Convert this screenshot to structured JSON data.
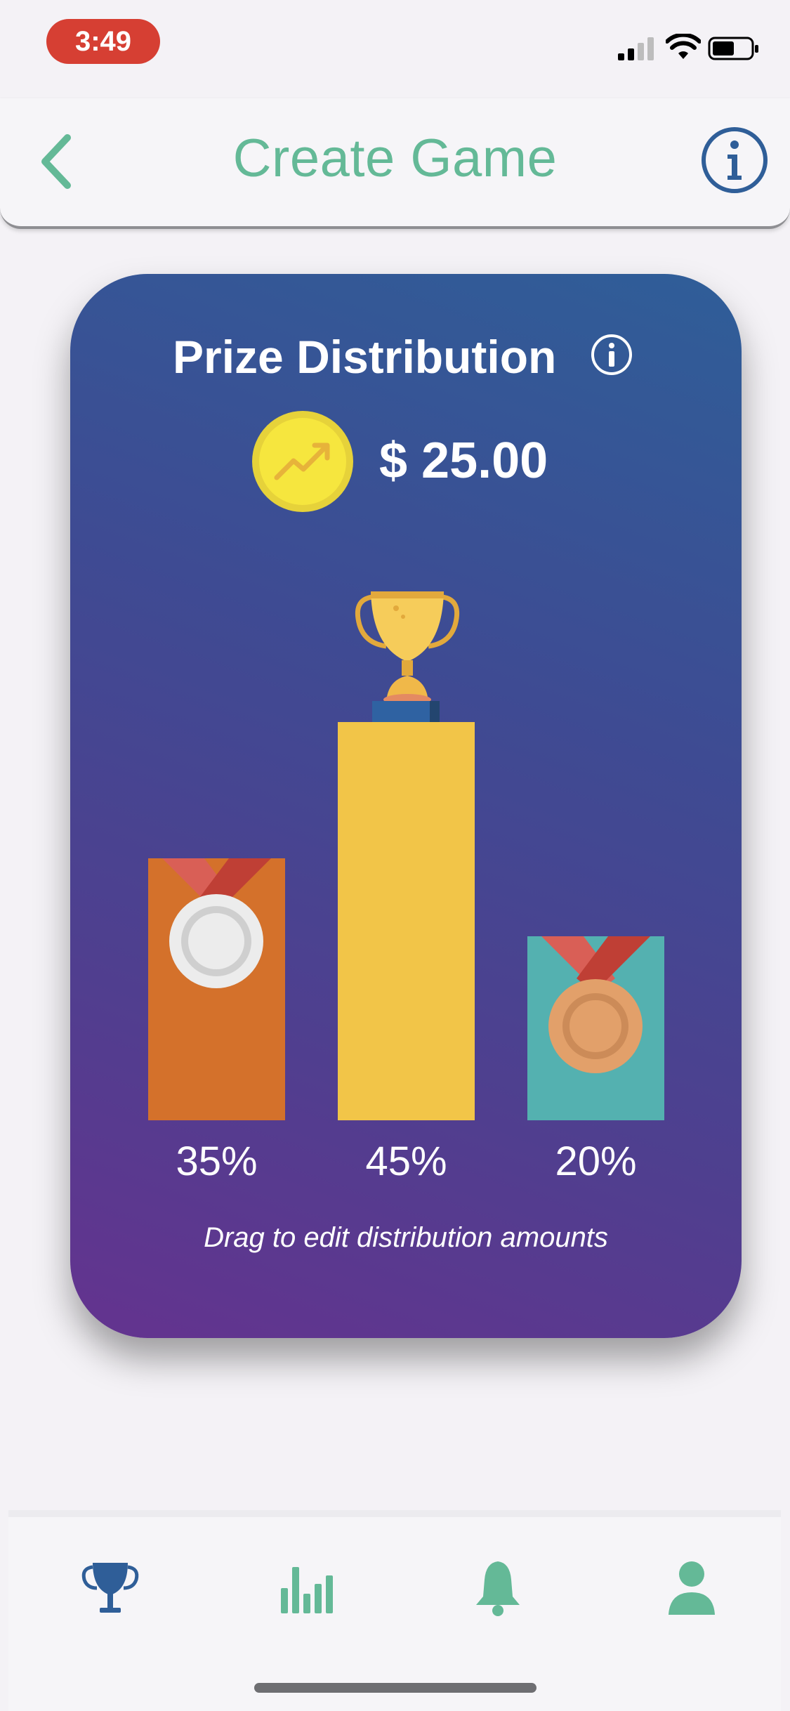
{
  "status_bar": {
    "time": "3:49"
  },
  "header": {
    "title": "Create Game",
    "back_icon": "chevron-left-icon",
    "info_icon": "info-circle-icon"
  },
  "card": {
    "title": "Prize Distribution",
    "amount": "$ 25.00",
    "hint": "Drag to edit distribution amounts",
    "places": [
      {
        "place": "second",
        "percent_label": "35%",
        "percent": 35,
        "icon": "silver-medal-icon",
        "color": "#d4712b"
      },
      {
        "place": "first",
        "percent_label": "45%",
        "percent": 45,
        "icon": "trophy-icon",
        "color": "#f2c548"
      },
      {
        "place": "third",
        "percent_label": "20%",
        "percent": 20,
        "icon": "bronze-medal-icon",
        "color": "#54b1b0"
      }
    ]
  },
  "tab_bar": {
    "items": [
      {
        "name": "trophy",
        "icon": "trophy-icon",
        "active": true
      },
      {
        "name": "stats",
        "icon": "bar-chart-icon",
        "active": false
      },
      {
        "name": "notifications",
        "icon": "bell-icon",
        "active": false
      },
      {
        "name": "profile",
        "icon": "person-icon",
        "active": false
      }
    ]
  },
  "colors": {
    "accent_green": "#64b997",
    "active_blue": "#2f5e98",
    "status_pill": "#d63f33"
  }
}
